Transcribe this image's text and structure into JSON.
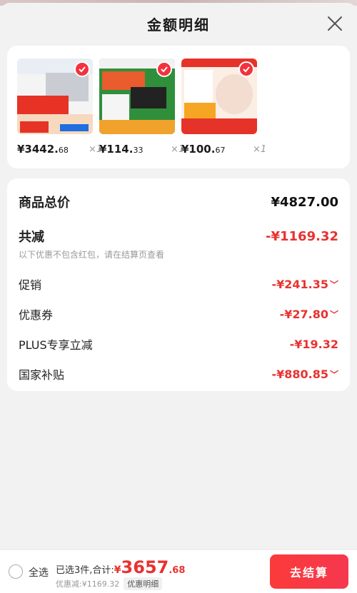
{
  "header": {
    "title": "金额明细"
  },
  "products": [
    {
      "price_int": "¥3442.",
      "price_dec": "68",
      "qty": "×1"
    },
    {
      "price_int": "¥114.",
      "price_dec": "33",
      "qty": "×1"
    },
    {
      "price_int": "¥100.",
      "price_dec": "67",
      "qty": "×1"
    }
  ],
  "summary": {
    "total_label": "商品总价",
    "total_value": "¥4827.00",
    "reduce_label": "共减",
    "reduce_value": "-¥1169.32",
    "note": "以下优惠不包含红包，请在结算页查看",
    "promo_label": "促销",
    "promo_value": "-¥241.35",
    "coupon_label": "优惠券",
    "coupon_value": "-¥27.80",
    "plus_label": "PLUS专享立减",
    "plus_value": "-¥19.32",
    "subsidy_label": "国家补贴",
    "subsidy_value": "-¥880.85"
  },
  "bottom": {
    "select_all": "全选",
    "selected_text": "已选3件,合计:",
    "yen": "¥",
    "total_int": "3657",
    "total_dec": ".68",
    "discount_text": "优惠减:¥1169.32",
    "detail_label": "优惠明细",
    "checkout_label": "去结算"
  },
  "colors": {
    "accent": "#e8322f",
    "checkout": "#fb3a3a"
  }
}
